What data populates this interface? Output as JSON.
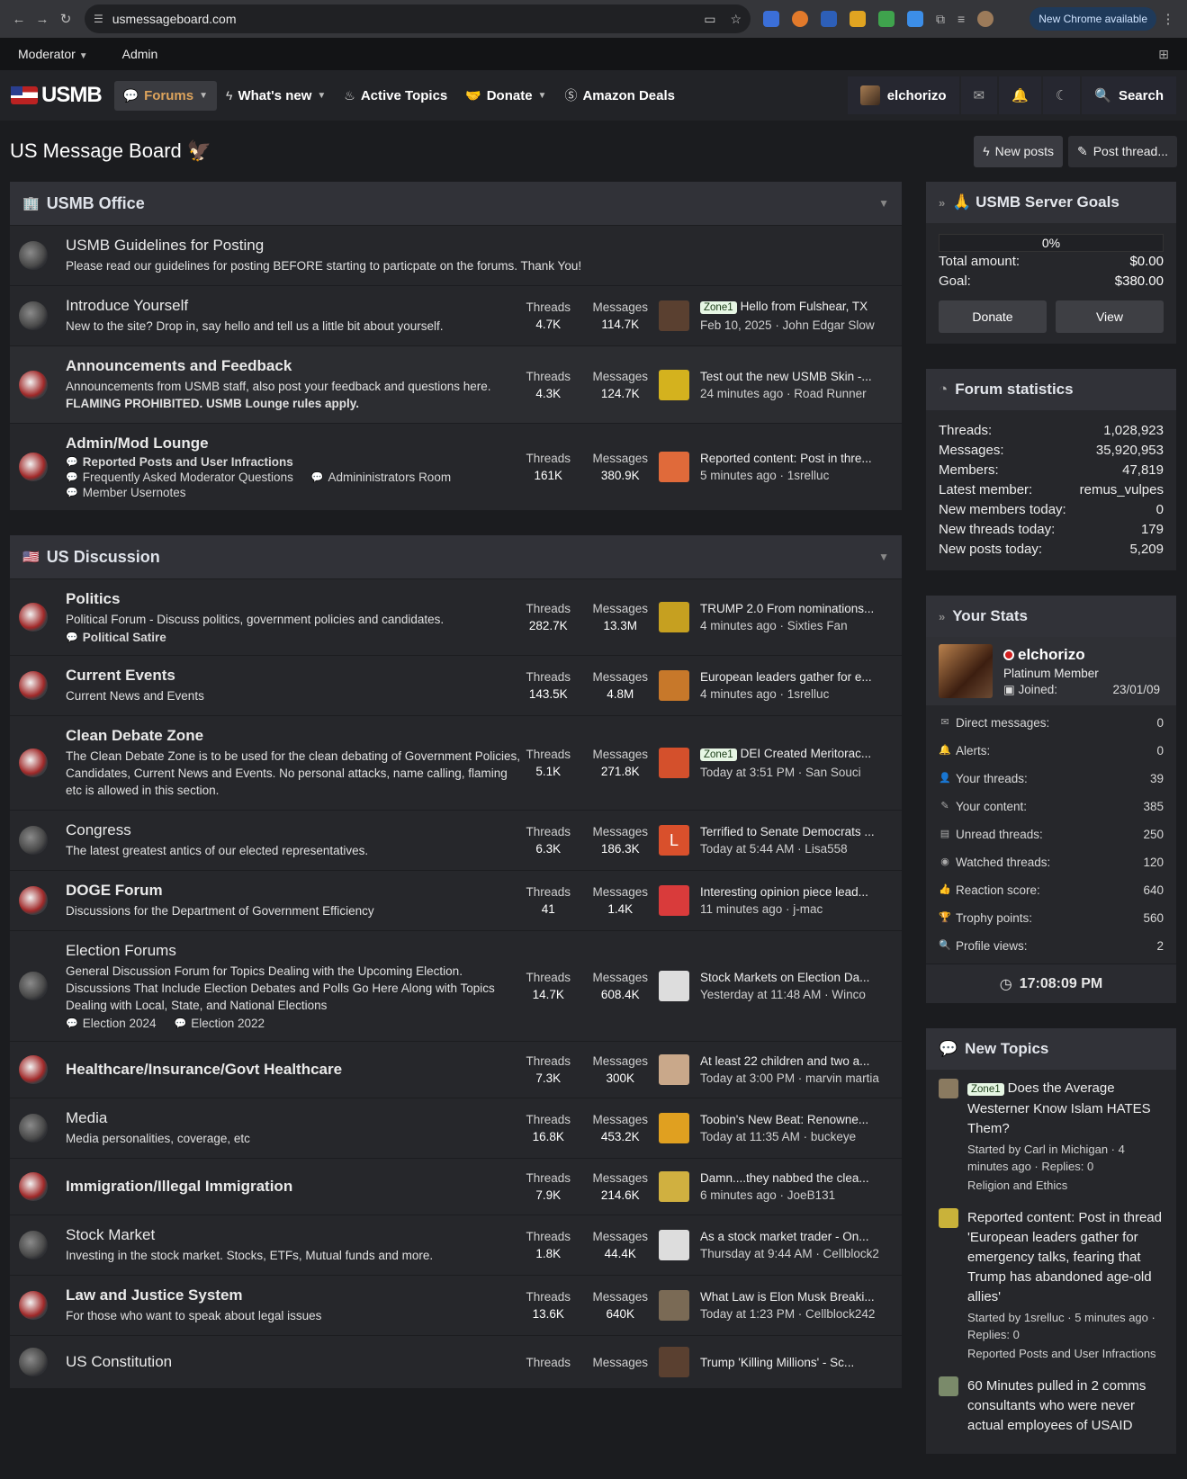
{
  "browser": {
    "url": "usmessageboard.com",
    "update": "New Chrome available"
  },
  "modbar": {
    "moderator": "Moderator",
    "admin": "Admin"
  },
  "nav": {
    "logo": "USMB",
    "forums": "Forums",
    "whats_new": "What's new",
    "active_topics": "Active Topics",
    "donate": "Donate",
    "amazon": "Amazon Deals",
    "user": "elchorizo",
    "search": "Search"
  },
  "page": {
    "title": "US Message Board 🦅",
    "new_posts": "New posts",
    "post_thread": "Post thread..."
  },
  "sections": [
    {
      "title": "USMB Office",
      "nodes": [
        {
          "title": "USMB Guidelines for Posting",
          "desc": "Please read our guidelines for posting BEFORE starting to particpate on the forums. Thank You!",
          "unread": false,
          "nostats": true
        },
        {
          "title": "Introduce Yourself",
          "desc": "New to the site? Drop in, say hello and tell us a little bit about yourself.",
          "unread": false,
          "threads": "4.7K",
          "messages": "114.7K",
          "label": "Zone1",
          "last_title": "Hello from Fulshear, TX",
          "last_meta": "Feb 10, 2025 · John Edgar Slow"
        },
        {
          "title": "Announcements and Feedback",
          "desc": "Announcements from USMB staff, also post your feedback and questions here.",
          "desc2": "FLAMING PROHIBITED. USMB Lounge rules apply.",
          "unread": true,
          "threads": "4.3K",
          "messages": "124.7K",
          "last_title": "Test out the new USMB Skin -...",
          "last_meta": "24 minutes ago · Road Runner"
        },
        {
          "title": "Admin/Mod Lounge",
          "unread": true,
          "subs": [
            {
              "t": "Reported Posts and User Infractions",
              "b": true
            },
            {
              "t": "Frequently Asked Moderator Questions"
            },
            {
              "t": "Admininistrators Room"
            },
            {
              "t": "Member Usernotes"
            }
          ],
          "threads": "161K",
          "messages": "380.9K",
          "last_title": "Reported content: Post in thre...",
          "last_meta": "5 minutes ago · 1srelluc"
        }
      ]
    },
    {
      "title": "US Discussion",
      "nodes": [
        {
          "title": "Politics",
          "desc": "Political Forum - Discuss politics, government policies and candidates.",
          "unread": true,
          "subs": [
            {
              "t": "Political Satire",
              "b": true
            }
          ],
          "threads": "282.7K",
          "messages": "13.3M",
          "last_title": "TRUMP 2.0 From nominations...",
          "last_meta": "4 minutes ago · Sixties Fan"
        },
        {
          "title": "Current Events",
          "desc": "Current News and Events",
          "unread": true,
          "threads": "143.5K",
          "messages": "4.8M",
          "last_title": "European leaders gather for e...",
          "last_meta": "4 minutes ago · 1srelluc"
        },
        {
          "title": "Clean Debate Zone",
          "desc": "The Clean Debate Zone is to be used for the clean debating of Government Policies, Candidates, Current News and Events. No personal attacks, name calling, flaming etc is allowed in this section.",
          "unread": true,
          "threads": "5.1K",
          "messages": "271.8K",
          "label": "Zone1",
          "last_title": "DEI Created Meritorac...",
          "last_meta": "Today at 3:51 PM · San Souci"
        },
        {
          "title": "Congress",
          "desc": "The latest greatest antics of our elected representatives.",
          "unread": false,
          "threads": "6.3K",
          "messages": "186.3K",
          "avatar_letter": "L",
          "last_title": "Terrified to Senate Democrats ...",
          "last_meta": "Today at 5:44 AM · Lisa558"
        },
        {
          "title": "DOGE Forum",
          "desc": "Discussions for the Department of Government Efficiency",
          "unread": true,
          "threads": "41",
          "messages": "1.4K",
          "last_title": "Interesting opinion piece lead...",
          "last_meta": "11 minutes ago · j-mac"
        },
        {
          "title": "Election Forums",
          "desc": "General Discussion Forum for Topics Dealing with the Upcoming Election. Discussions That Include Election Debates and Polls Go Here Along with Topics Dealing with Local, State, and National Elections",
          "unread": false,
          "subs": [
            {
              "t": "Election 2024"
            },
            {
              "t": "Election 2022"
            }
          ],
          "threads": "14.7K",
          "messages": "608.4K",
          "last_title": "Stock Markets on Election Da...",
          "last_meta": "Yesterday at 11:48 AM · Winco"
        },
        {
          "title": "Healthcare/Insurance/Govt Healthcare",
          "unread": true,
          "threads": "7.3K",
          "messages": "300K",
          "last_title": "At least 22 children and two a...",
          "last_meta": "Today at 3:00 PM · marvin martia"
        },
        {
          "title": "Media",
          "desc": "Media personalities, coverage, etc",
          "unread": false,
          "threads": "16.8K",
          "messages": "453.2K",
          "last_title": "Toobin's New Beat: Renowne...",
          "last_meta": "Today at 11:35 AM · buckeye"
        },
        {
          "title": "Immigration/Illegal Immigration",
          "unread": true,
          "threads": "7.9K",
          "messages": "214.6K",
          "last_title": "Damn....they nabbed the clea...",
          "last_meta": "6 minutes ago · JoeB131"
        },
        {
          "title": "Stock Market",
          "desc": "Investing in the stock market. Stocks, ETFs, Mutual funds and more.",
          "unread": false,
          "threads": "1.8K",
          "messages": "44.4K",
          "last_title": "As a stock market trader - On...",
          "last_meta": "Thursday at 9:44 AM · Cellblock2"
        },
        {
          "title": "Law and Justice System",
          "desc": "For those who want to speak about legal issues",
          "unread": true,
          "threads": "13.6K",
          "messages": "640K",
          "last_title": "What Law is Elon Musk Breaki...",
          "last_meta": "Today at 1:23 PM · Cellblock242"
        },
        {
          "title": "US Constitution",
          "unread": false,
          "threads": "",
          "messages": "",
          "last_title": "Trump 'Killing Millions' - Sc...",
          "last_meta": ""
        }
      ]
    }
  ],
  "labels": {
    "threads": "Threads",
    "messages": "Messages"
  },
  "goals": {
    "title": "🙏 USMB Server Goals",
    "percent": "0%",
    "total_label": "Total amount:",
    "total": "$0.00",
    "goal_label": "Goal:",
    "goal": "$380.00",
    "donate": "Donate",
    "view": "View"
  },
  "forum_stats": {
    "title": "Forum statistics",
    "rows": [
      {
        "k": "Threads:",
        "v": "1,028,923"
      },
      {
        "k": "Messages:",
        "v": "35,920,953"
      },
      {
        "k": "Members:",
        "v": "47,819"
      },
      {
        "k": "Latest member:",
        "v": "remus_vulpes"
      },
      {
        "k": "New members today:",
        "v": "0"
      },
      {
        "k": "New threads today:",
        "v": "179"
      },
      {
        "k": "New posts today:",
        "v": "5,209"
      }
    ]
  },
  "your_stats": {
    "title": "Your Stats",
    "name": "elchorizo",
    "role": "Platinum Member",
    "joined_label": "Joined:",
    "joined": "23/01/09",
    "rows": [
      {
        "k": "Direct messages:",
        "v": "0",
        "i": "✉"
      },
      {
        "k": "Alerts:",
        "v": "0",
        "i": "🔔"
      },
      {
        "k": "Your threads:",
        "v": "39",
        "i": "👤"
      },
      {
        "k": "Your content:",
        "v": "385",
        "i": "✎"
      },
      {
        "k": "Unread threads:",
        "v": "250",
        "i": "▤"
      },
      {
        "k": "Watched threads:",
        "v": "120",
        "i": "◉"
      },
      {
        "k": "Reaction score:",
        "v": "640",
        "i": "👍"
      },
      {
        "k": "Trophy points:",
        "v": "560",
        "i": "🏆"
      },
      {
        "k": "Profile views:",
        "v": "2",
        "i": "🔍"
      }
    ],
    "time": "17:08:09 PM"
  },
  "new_topics": {
    "title": "New Topics",
    "items": [
      {
        "label": "Zone1",
        "title": "Does the Average Westerner Know Islam HATES Them?",
        "meta": "Started by Carl in Michigan · 4 minutes ago · Replies: 0",
        "forum": "Religion and Ethics"
      },
      {
        "title": "Reported content: Post in thread 'European leaders gather for emergency talks, fearing that Trump has abandoned age-old allies'",
        "meta": "Started by 1srelluc · 5 minutes ago · Replies: 0",
        "forum": "Reported Posts and User Infractions"
      },
      {
        "title": "60 Minutes pulled in 2 comms consultants who were never actual employees of USAID",
        "meta": "",
        "forum": ""
      }
    ]
  }
}
